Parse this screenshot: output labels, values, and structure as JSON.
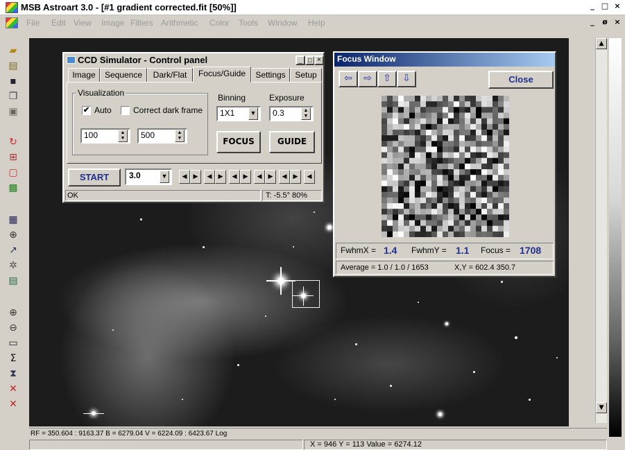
{
  "app": {
    "title": "MSB Astroart 3.0 - [#1 gradient corrected.fit  [50%]]",
    "window_controls": [
      "_",
      "□",
      "×"
    ],
    "child_controls": [
      "_",
      "ø",
      "×"
    ]
  },
  "menu": [
    "File",
    "Edit",
    "View",
    "Image",
    "Filters",
    "Arithmetic",
    "Color",
    "Tools",
    "Window",
    "Help"
  ],
  "toolbar_icons": [
    "open-folder-icon",
    "folder-icon",
    "save-icon",
    "copy-icon",
    "clipboard-icon",
    "rotate-icon",
    "compare-icon",
    "layers-icon",
    "rgb-icon",
    "histogram-icon",
    "magnify-icon",
    "xy-icon",
    "stars-icon",
    "doc-icon",
    "zoom-in-icon",
    "zoom-out-icon",
    "fit-icon",
    "sigma-icon",
    "graph-icon",
    "expand-icon",
    "shrink-icon"
  ],
  "ccd_panel": {
    "title": "CCD Simulator - Control panel",
    "tabs": [
      "Image",
      "Sequence",
      "Dark/Flat",
      "Focus/Guide",
      "Settings",
      "Setup"
    ],
    "active_tab": "Focus/Guide",
    "visualization_label": "Visualization",
    "auto_label": "Auto",
    "auto_checked": "✔",
    "correct_dark_label": "Correct dark frame",
    "min_value": "100",
    "max_value": "500",
    "binning_label": "Binning",
    "binning_value": "1X1",
    "exposure_label": "Exposure",
    "exposure_value": "0.3",
    "focus_button": "FOCUS",
    "guide_button": "GUIDE",
    "start_button": "START",
    "step_value": "3.0",
    "status_left": "OK",
    "status_right": "T: -5.5° 80%"
  },
  "focus_window": {
    "title": "Focus Window",
    "close_button": "Close",
    "fwhmx_label": "FwhmX =",
    "fwhmx_value": "1.4",
    "fwhmy_label": "FwhmY =",
    "fwhmy_value": "1.1",
    "focus_label": "Focus =",
    "focus_value": "1708",
    "average_text": "Average = 1.0 / 1.0 / 1653",
    "xy_text": "X,Y = 602.4  350.7"
  },
  "status_bar": {
    "info": "RF = 350.604 : 9163.37   B = 6279.04   V = 6224.09 : 6423.67 Log",
    "coords": "X = 946   Y = 113   Value = 6274.12"
  }
}
